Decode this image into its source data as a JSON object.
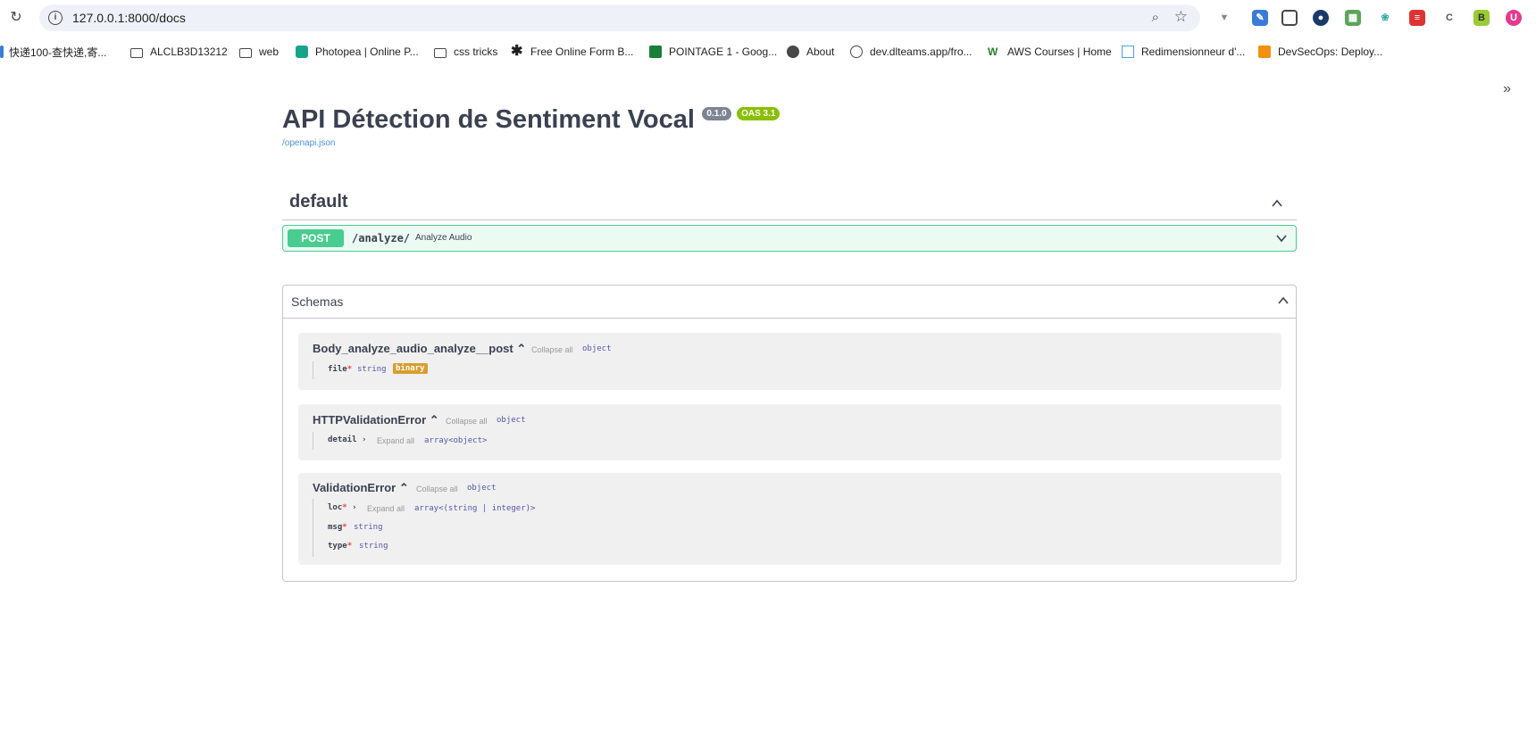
{
  "browser": {
    "url": "127.0.0.1:8000/docs",
    "bookmarks": [
      "快递100-查快递,寄...",
      "ALCLB3D13212",
      "web",
      "Photopea | Online P...",
      "css tricks",
      "Free Online Form B...",
      "POINTAGE 1 - Goog...",
      "About",
      "dev.dlteams.app/fro...",
      "AWS Courses | Home",
      "Redimensionneur d'...",
      "DevSecOps: Deploy..."
    ],
    "more": "»"
  },
  "info": {
    "title": "API Détection de Sentiment Vocal",
    "version": "0.1.0",
    "oas": "OAS 3.1",
    "spec_link": "/openapi.json"
  },
  "tag": {
    "name": "default"
  },
  "operation": {
    "method": "POST",
    "path": "/analyze/",
    "summary": "Analyze Audio"
  },
  "schemas": {
    "title": "Schemas",
    "models": [
      {
        "name": "Body_analyze_audio_analyze__post",
        "toggle": "Collapse all",
        "type": "object",
        "props": [
          {
            "name": "file",
            "required": "*",
            "type": "string",
            "format": "binary"
          }
        ]
      },
      {
        "name": "HTTPValidationError",
        "toggle": "Collapse all",
        "type": "object",
        "props": [
          {
            "name": "detail",
            "expand": "Expand all",
            "type": "array<object>"
          }
        ]
      },
      {
        "name": "ValidationError",
        "toggle": "Collapse all",
        "type": "object",
        "props": [
          {
            "name": "loc",
            "required": "*",
            "expand": "Expand all",
            "type": "array<(string | integer)>"
          },
          {
            "name": "msg",
            "required": "*",
            "type": "string"
          },
          {
            "name": "type",
            "required": "*",
            "type": "string"
          }
        ]
      }
    ]
  }
}
